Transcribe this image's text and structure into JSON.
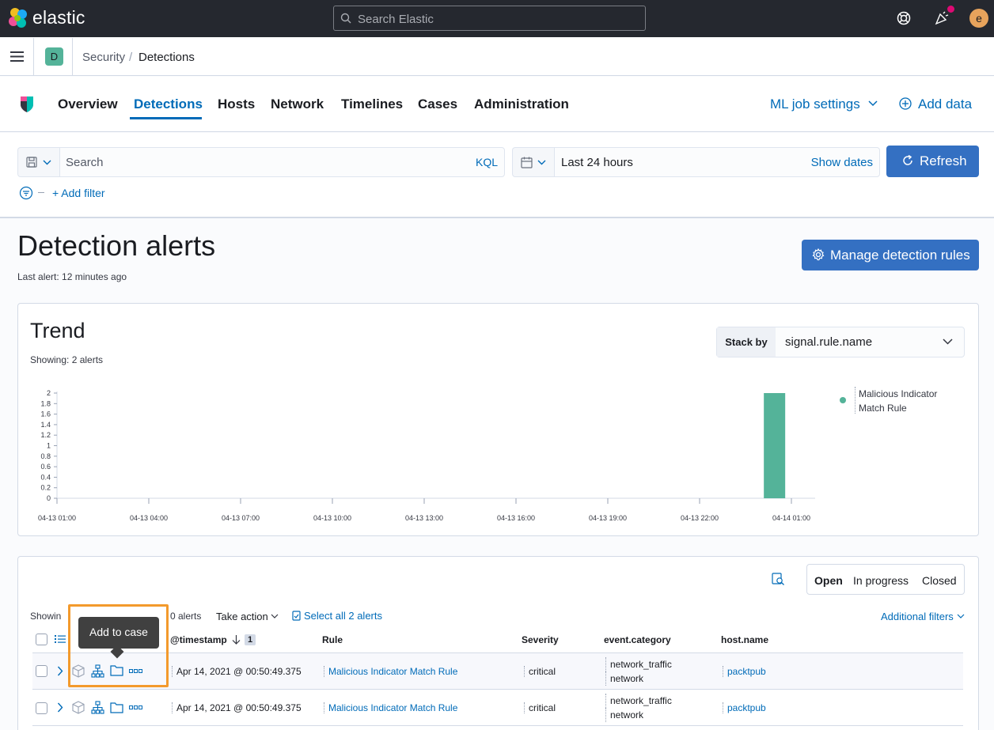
{
  "brand": "elastic",
  "global_search": {
    "placeholder": "Search Elastic"
  },
  "user": {
    "initial": "e"
  },
  "breadcrumb": {
    "space": "D",
    "items": [
      "Security",
      "Detections"
    ],
    "separator": "/"
  },
  "nav": {
    "tabs": [
      "Overview",
      "Detections",
      "Hosts",
      "Network",
      "Timelines",
      "Cases",
      "Administration"
    ],
    "active": "Detections",
    "ml_settings": "ML job settings",
    "add_data": "Add data"
  },
  "query": {
    "placeholder": "Search",
    "language": "KQL",
    "date_range": "Last 24 hours",
    "show_dates": "Show dates",
    "refresh": "Refresh",
    "add_filter": "+ Add filter"
  },
  "page": {
    "title": "Detection alerts",
    "last_alert": "Last alert: 12 minutes ago",
    "manage_rules": "Manage detection rules"
  },
  "trend": {
    "title": "Trend",
    "showing": "Showing: 2 alerts",
    "stack_by_label": "Stack by",
    "stack_by_value": "signal.rule.name",
    "legend": "Malicious Indicator Match Rule"
  },
  "chart_data": {
    "type": "bar",
    "series": [
      {
        "name": "Malicious Indicator Match Rule",
        "color": "#54b399"
      }
    ],
    "x_ticks": [
      "04-13 01:00",
      "04-13 04:00",
      "04-13 07:00",
      "04-13 10:00",
      "04-13 13:00",
      "04-13 16:00",
      "04-13 19:00",
      "04-13 22:00",
      "04-14 01:00"
    ],
    "y_ticks": [
      "0",
      "0.2",
      "0.4",
      "0.6",
      "0.8",
      "1",
      "1.2",
      "1.4",
      "1.6",
      "1.8",
      "2"
    ],
    "ylim": [
      0,
      2
    ],
    "points": [
      {
        "x": "04-14 00:30",
        "value": 2
      }
    ]
  },
  "table": {
    "showing": "Showin",
    "showing_tail": "0 alerts",
    "take_action": "Take action",
    "select_all": "Select all 2 alerts",
    "additional_filters": "Additional filters",
    "status": [
      "Open",
      "In progress",
      "Closed"
    ],
    "status_active": "Open",
    "columns": [
      "@timestamp",
      "Rule",
      "Severity",
      "event.category",
      "host.name"
    ],
    "sort_count": "1",
    "tooltip": "Add to case",
    "rows": [
      {
        "timestamp": "Apr 14, 2021 @ 00:50:49.375",
        "rule": "Malicious Indicator Match Rule",
        "severity": "critical",
        "category": [
          "network_traffic",
          "network"
        ],
        "host": "packtpub"
      },
      {
        "timestamp": "Apr 14, 2021 @ 00:50:49.375",
        "rule": "Malicious Indicator Match Rule",
        "severity": "critical",
        "category": [
          "network_traffic",
          "network"
        ],
        "host": "packtpub"
      }
    ]
  },
  "colors": {
    "accent": "#006bb8",
    "button": "#3470c2",
    "series": "#54b399",
    "highlight": "#f39a2c"
  }
}
